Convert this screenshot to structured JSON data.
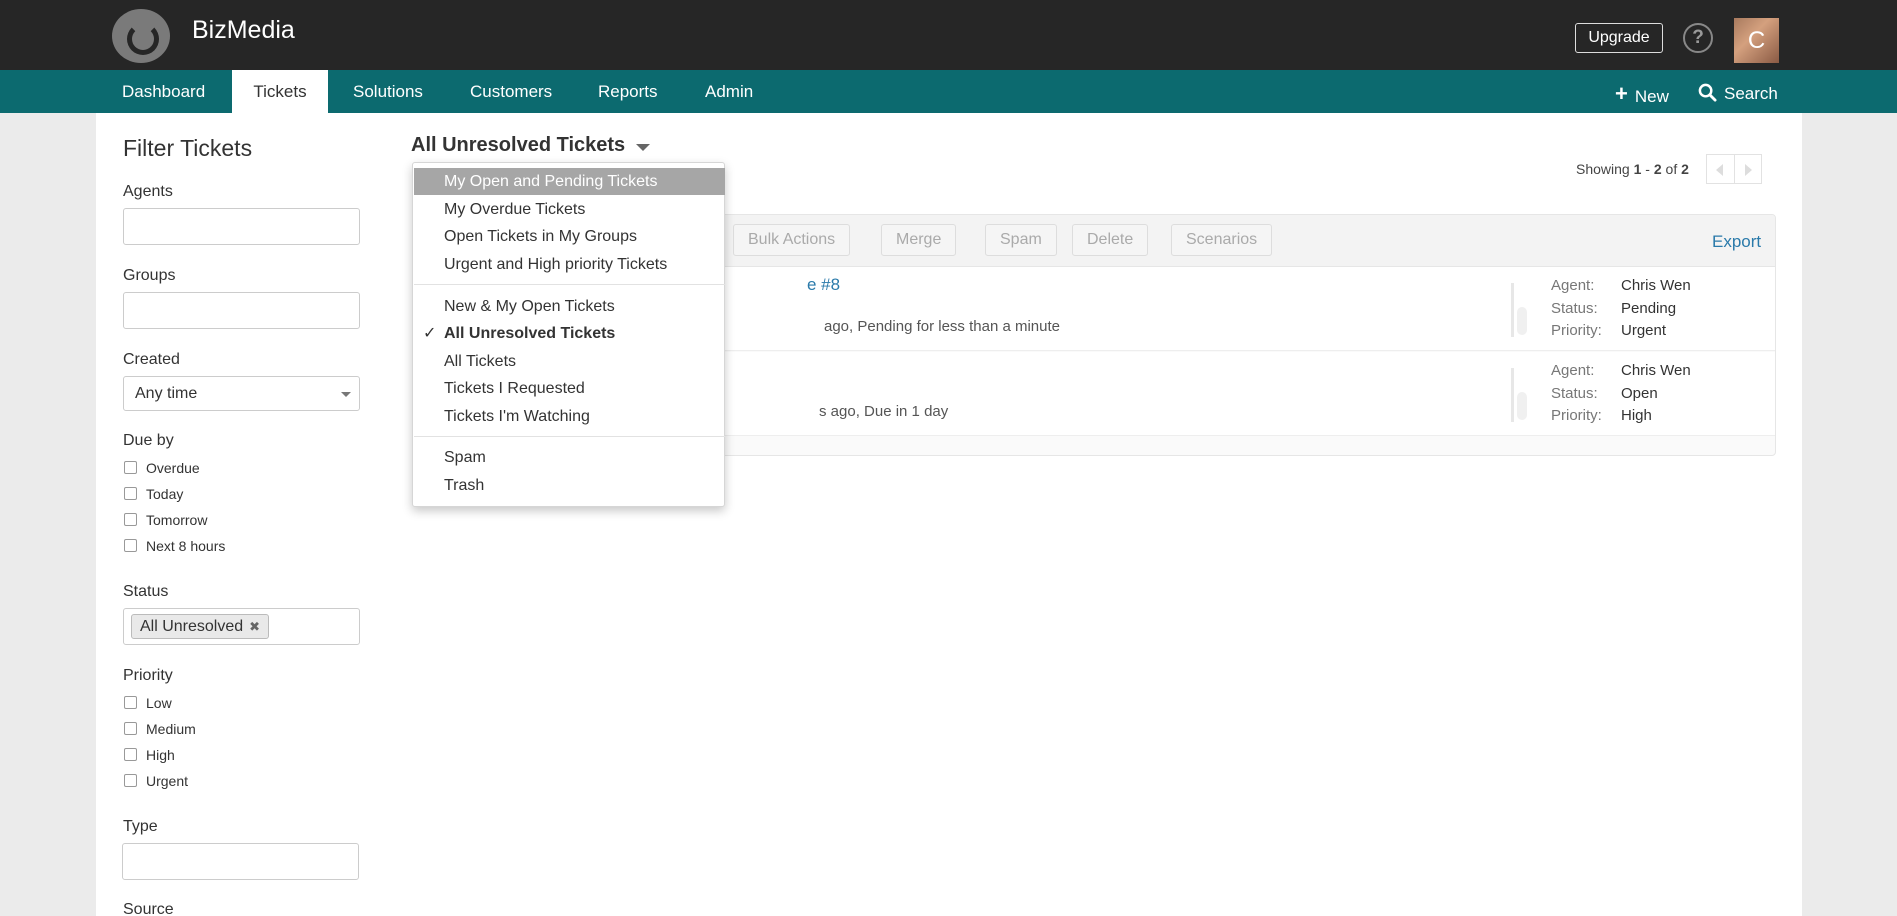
{
  "app": {
    "brand": "BizMedia",
    "upgrade_label": "Upgrade",
    "help_glyph": "?",
    "avatar_letter": "C"
  },
  "nav": {
    "tabs": [
      "Dashboard",
      "Tickets",
      "Solutions",
      "Customers",
      "Reports",
      "Admin"
    ],
    "active_tab": "Tickets",
    "new_label": "New",
    "search_label": "Search"
  },
  "sidebar": {
    "title": "Filter Tickets",
    "agents_label": "Agents",
    "groups_label": "Groups",
    "created_label": "Created",
    "created_value": "Any time",
    "due_label": "Due by",
    "due_options": [
      "Overdue",
      "Today",
      "Tomorrow",
      "Next 8 hours"
    ],
    "status_label": "Status",
    "status_chip": "All Unresolved",
    "status_chip_remove": "✖",
    "priority_label": "Priority",
    "priority_options": [
      "Low",
      "Medium",
      "High",
      "Urgent"
    ],
    "type_label": "Type",
    "source_label": "Source"
  },
  "view": {
    "title": "All Unresolved Tickets"
  },
  "pagination": {
    "prefix": "Showing ",
    "from": "1",
    "sep": " - ",
    "to": "2",
    "of_word": " of ",
    "total": "2"
  },
  "toolbar": {
    "buttons": [
      "Bulk Actions",
      "Merge",
      "Spam",
      "Delete",
      "Scenarios"
    ],
    "export_label": "Export"
  },
  "tickets": [
    {
      "subject_fragment": "e #8",
      "meta_fragment": "ago, Pending for less than a minute",
      "agent_key": "Agent:",
      "agent": "Chris Wen",
      "status_key": "Status:",
      "status": "Pending",
      "priority_key": "Priority:",
      "priority": "Urgent"
    },
    {
      "subject_fragment": "",
      "meta_fragment": "s ago, Due in 1 day",
      "agent_key": "Agent:",
      "agent": "Chris Wen",
      "status_key": "Status:",
      "status": "Open",
      "priority_key": "Priority:",
      "priority": "High"
    }
  ],
  "dropdown": {
    "check_glyph": "✓",
    "group1": [
      "My Open and Pending Tickets",
      "My Overdue Tickets",
      "Open Tickets in My Groups",
      "Urgent and High priority Tickets"
    ],
    "group2": [
      "New & My Open Tickets",
      "All Unresolved Tickets",
      "All Tickets",
      "Tickets I Requested",
      "Tickets I'm Watching"
    ],
    "group3": [
      "Spam",
      "Trash"
    ],
    "highlighted": "My Open and Pending Tickets",
    "selected": "All Unresolved Tickets"
  },
  "colors": {
    "topbar": "#262626",
    "navbar": "#0c6a6f",
    "link": "#2a7aaa",
    "highlight": "#a6a6a6"
  }
}
